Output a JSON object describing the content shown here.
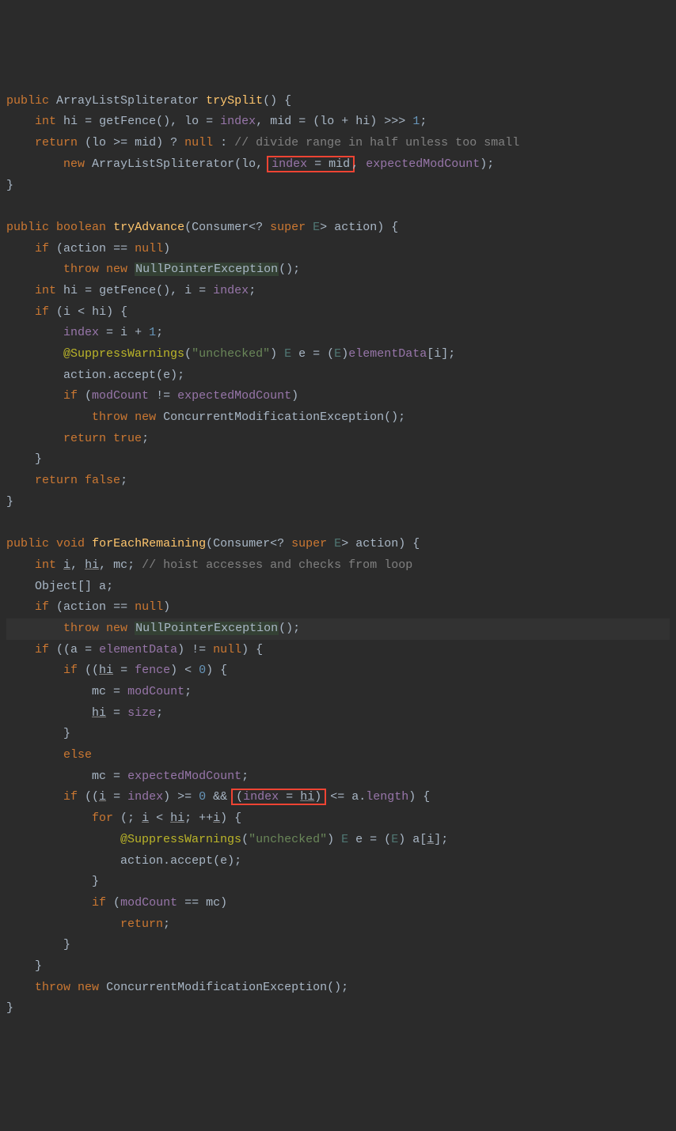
{
  "kw": {
    "public": "public",
    "int": "int",
    "return": "return",
    "new": "new",
    "null": "null",
    "if": "if",
    "throw": "throw",
    "boolean": "boolean",
    "super": "super",
    "true": "true",
    "false": "false",
    "void": "void",
    "else": "else",
    "for": "for"
  },
  "fn": {
    "trySplit": "trySplit",
    "tryAdvance": "tryAdvance",
    "forEachRemaining": "forEachRemaining"
  },
  "type": {
    "ArrayListSpliterator": "ArrayListSpliterator",
    "Consumer": "Consumer",
    "NullPointerException": "NullPointerException",
    "ConcurrentModificationException": "ConcurrentModificationException",
    "Object": "Object",
    "E": "E"
  },
  "id": {
    "hi": "hi",
    "lo": "lo",
    "mid": "mid",
    "index": "index",
    "getFence": "getFence",
    "expectedModCount": "expectedModCount",
    "action": "action",
    "i": "i",
    "e": "e",
    "elementData": "elementData",
    "accept": "accept",
    "modCount": "modCount",
    "mc": "mc",
    "a": "a",
    "fence": "fence",
    "size": "size",
    "length": "length"
  },
  "cmt": {
    "c1": "// divide range in half unless too small",
    "c2": "// hoist accesses and checks from loop"
  },
  "str": {
    "unchecked": "\"unchecked\""
  },
  "num": {
    "n0": "0",
    "n1": "1"
  },
  "annot": {
    "supp": "@SuppressWarnings"
  }
}
